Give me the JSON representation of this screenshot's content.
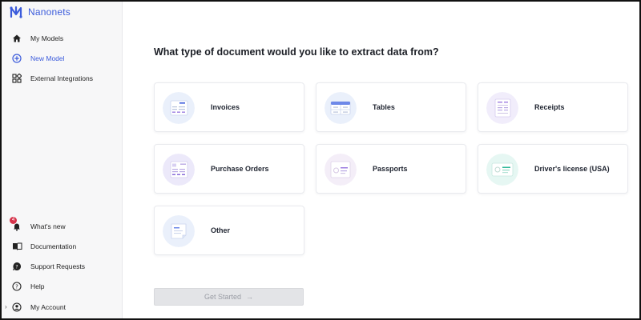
{
  "brand": {
    "name": "Nanonets",
    "accent": "#3b5bdb"
  },
  "sidebar": {
    "top_items": [
      {
        "label": "My Models",
        "icon": "home-icon"
      },
      {
        "label": "New Model",
        "icon": "plus-circle-icon",
        "active": true
      },
      {
        "label": "External Integrations",
        "icon": "integrations-icon"
      }
    ],
    "bottom_items": [
      {
        "label": "What's new",
        "icon": "bell-icon",
        "badge": "4"
      },
      {
        "label": "Documentation",
        "icon": "book-icon"
      },
      {
        "label": "Support Requests",
        "icon": "support-icon"
      },
      {
        "label": "Help",
        "icon": "help-icon"
      },
      {
        "label": "My Account",
        "icon": "account-icon"
      }
    ]
  },
  "main": {
    "title": "What type of document would you like to extract data from?",
    "cards": [
      {
        "label": "Invoices",
        "icon": "invoice-icon"
      },
      {
        "label": "Tables",
        "icon": "table-icon"
      },
      {
        "label": "Receipts",
        "icon": "receipt-icon"
      },
      {
        "label": "Purchase Orders",
        "icon": "purchase-order-icon"
      },
      {
        "label": "Passports",
        "icon": "passport-icon"
      },
      {
        "label": "Driver's license (USA)",
        "icon": "drivers-license-icon"
      },
      {
        "label": "Other",
        "icon": "document-icon"
      }
    ],
    "start_button": {
      "label": "Get Started",
      "arrow": "→"
    }
  }
}
